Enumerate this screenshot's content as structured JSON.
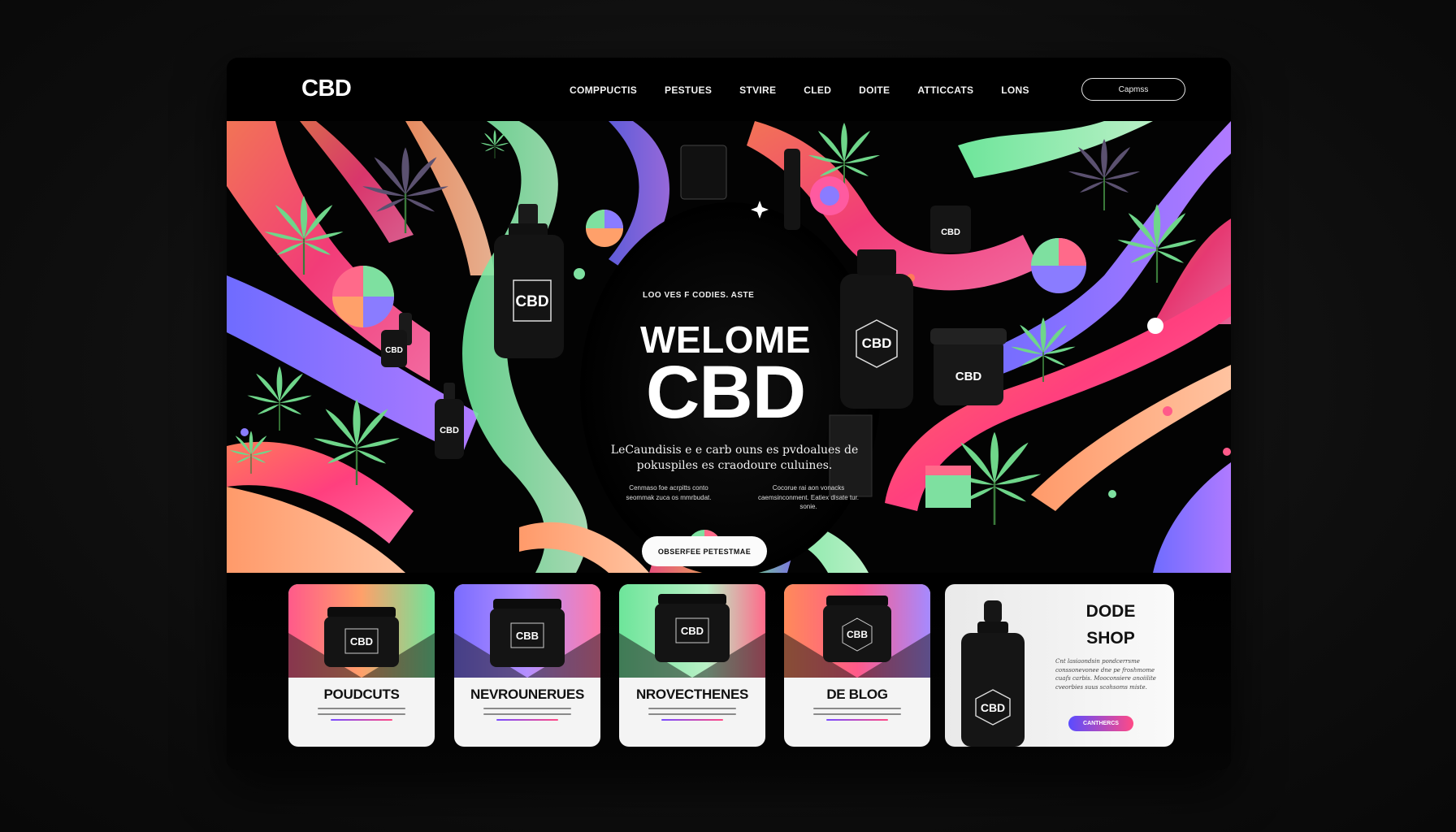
{
  "nav": {
    "logo": "CBD",
    "links": [
      "COMPPUCTIS",
      "PESTUES",
      "STVIRE",
      "CLED",
      "DOITE",
      "ATTICCATS",
      "LONS"
    ],
    "cta": "Capmss"
  },
  "hero": {
    "tagline": "LOO VES F CODIES. ASTE",
    "title_line1": "WELOME",
    "title_line2": "CBD",
    "description": "LeCaundisis e e carb ouns es pvdoalues de pokuspiles es craodoure culuines.",
    "col_left": "Cenmaso foe acrpitts conto seommak zuca os mmrbudat.",
    "col_right": "Cocorue rai aon vonacks caemsinconment. Eatiex disate tur. sonie.",
    "button": "OBSERFEE PETESTMAE",
    "bottle_labels": [
      "CBD",
      "CBD",
      "CBD",
      "CBD",
      "CBD",
      "CBD"
    ]
  },
  "cards": [
    {
      "title": "POUDCUTS",
      "jar_label": "CBD"
    },
    {
      "title": "NEVROUNERUES",
      "jar_label": "CBB"
    },
    {
      "title": "NROVECTHENES",
      "jar_label": "CBD"
    },
    {
      "title": "DE BLOG",
      "jar_label": "CBB"
    }
  ],
  "shop": {
    "title_line1": "DODE",
    "title_line2": "SHOP",
    "description": "Cnt lasiaondsin pondcerrsme conssonevonee dne pe froshmome cuafs carbis. Mooconsiere anoiilite cveorbies suus scohsoms miste.",
    "button": "CANTHERCS",
    "bottle_label": "CBD"
  },
  "colors": {
    "background": "#0d0d0d",
    "window": "#000000",
    "pink": "#ff4a86",
    "green": "#5ddc8a",
    "purple": "#7a5cff",
    "orange": "#ff8a4a"
  }
}
